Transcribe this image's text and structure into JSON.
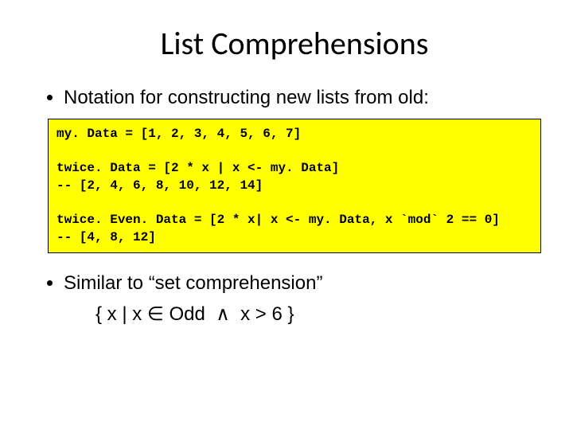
{
  "title": "List Comprehensions",
  "bullet1": "Notation for constructing new lists from old:",
  "code": {
    "line1": "my. Data = [1, 2, 3, 4, 5, 6, 7]",
    "line2": "twice. Data = [2 * x | x <- my. Data]",
    "line3": "-- [2, 4, 6, 8, 10, 12, 14]",
    "line4": "twice. Even. Data = [2 * x| x <- my. Data, x `mod` 2 == 0]",
    "line5": "-- [4, 8, 12]"
  },
  "bullet2": "Similar to “set comprehension”",
  "setnotation": "{ x | x ∈ Odd  ∧  x > 6 }"
}
